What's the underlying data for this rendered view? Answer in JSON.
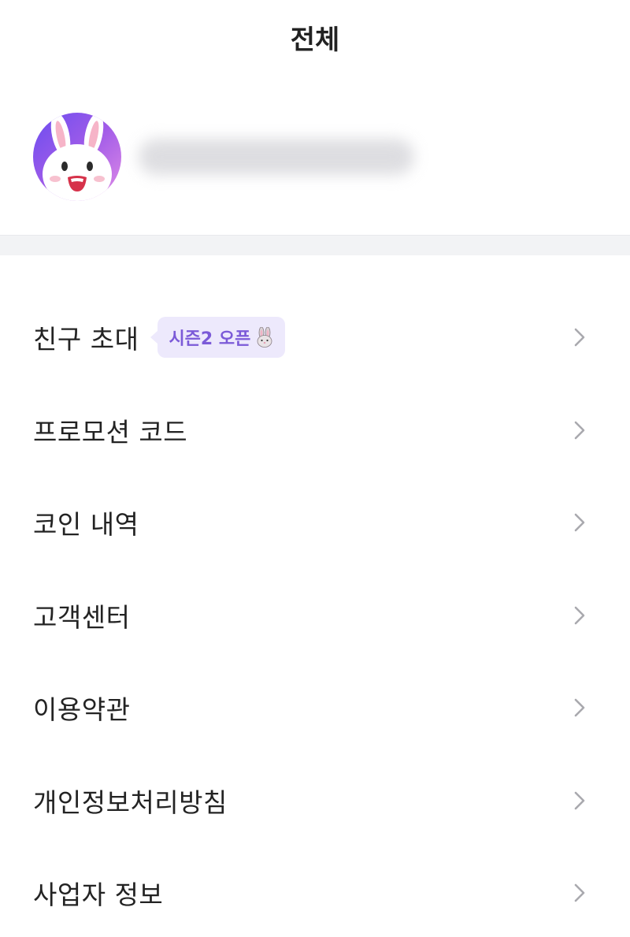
{
  "header": {
    "title": "전체"
  },
  "profile": {
    "email_hidden": true
  },
  "menu": {
    "items": [
      {
        "label": "친구 초대",
        "badge": "시즌2 오픈",
        "badge_emoji": "rabbit-face-icon"
      },
      {
        "label": "프로모션 코드"
      },
      {
        "label": "코인 내역"
      },
      {
        "label": "고객센터"
      },
      {
        "label": "이용약관"
      },
      {
        "label": "개인정보처리방침"
      },
      {
        "label": "사업자 정보"
      }
    ]
  },
  "colors": {
    "badge_bg": "#ede9fc",
    "badge_text": "#7b5ad8",
    "divider": "#f2f3f5",
    "chevron": "#a9a9ae"
  }
}
